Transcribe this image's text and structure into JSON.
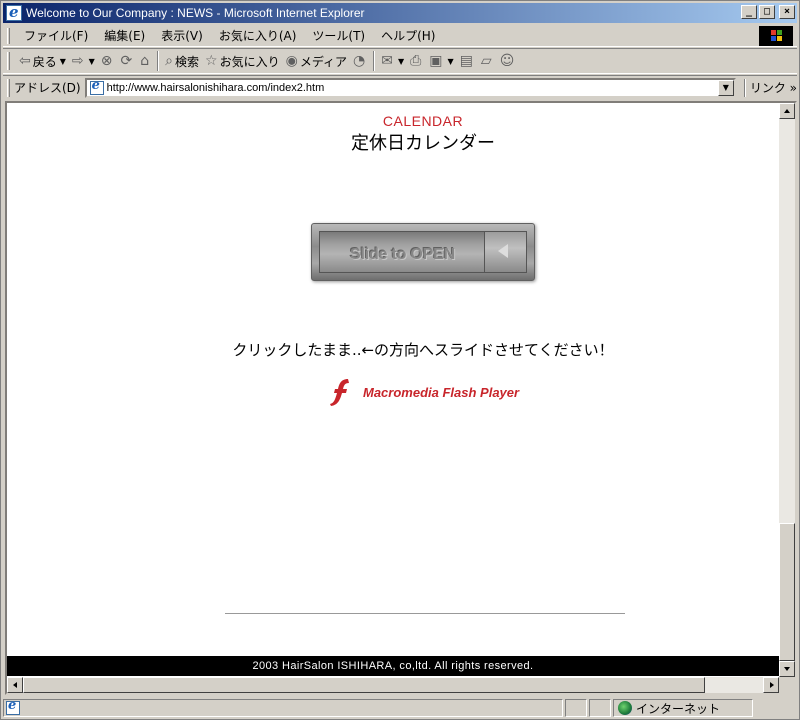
{
  "window": {
    "title": "Welcome to Our Company : NEWS - Microsoft Internet Explorer",
    "minimize_label": "_",
    "maximize_label": "□",
    "close_label": "×"
  },
  "menu": {
    "items": [
      "ファイル(F)",
      "編集(E)",
      "表示(V)",
      "お気に入り(A)",
      "ツール(T)",
      "ヘルプ(H)"
    ]
  },
  "toolbar": {
    "back_label": "戻る",
    "search_label": "検索",
    "favorites_label": "お気に入り",
    "media_label": "メディア"
  },
  "address": {
    "label": "アドレス(D)",
    "url": "http://www.hairsalonishihara.com/index2.htm",
    "links_label": "リンク"
  },
  "page": {
    "calendar_en": "CALENDAR",
    "calendar_ja": "定休日カレンダー",
    "slider_text": "Slide to OPEN",
    "instruction": "クリックしたまま..←の方向へスライドさせてください！",
    "flash_player_text": "Macromedia Flash Player",
    "footer": "2003 HairSalon ISHIHARA, co,ltd. All rights reserved."
  },
  "status": {
    "zone": "インターネット"
  },
  "colors": {
    "accent_red": "#c8252b",
    "titlebar_start": "#0a246a",
    "titlebar_end": "#a6caf0"
  },
  "icons": {
    "back": "back-arrow-icon",
    "forward": "forward-arrow-icon",
    "stop": "stop-icon",
    "refresh": "refresh-icon",
    "home": "home-icon",
    "search": "search-icon",
    "favorites": "favorites-icon",
    "media": "media-icon",
    "history": "history-icon",
    "mail": "mail-icon",
    "print": "print-icon",
    "edit": "edit-icon",
    "discuss": "discuss-icon",
    "messenger": "messenger-icon"
  }
}
